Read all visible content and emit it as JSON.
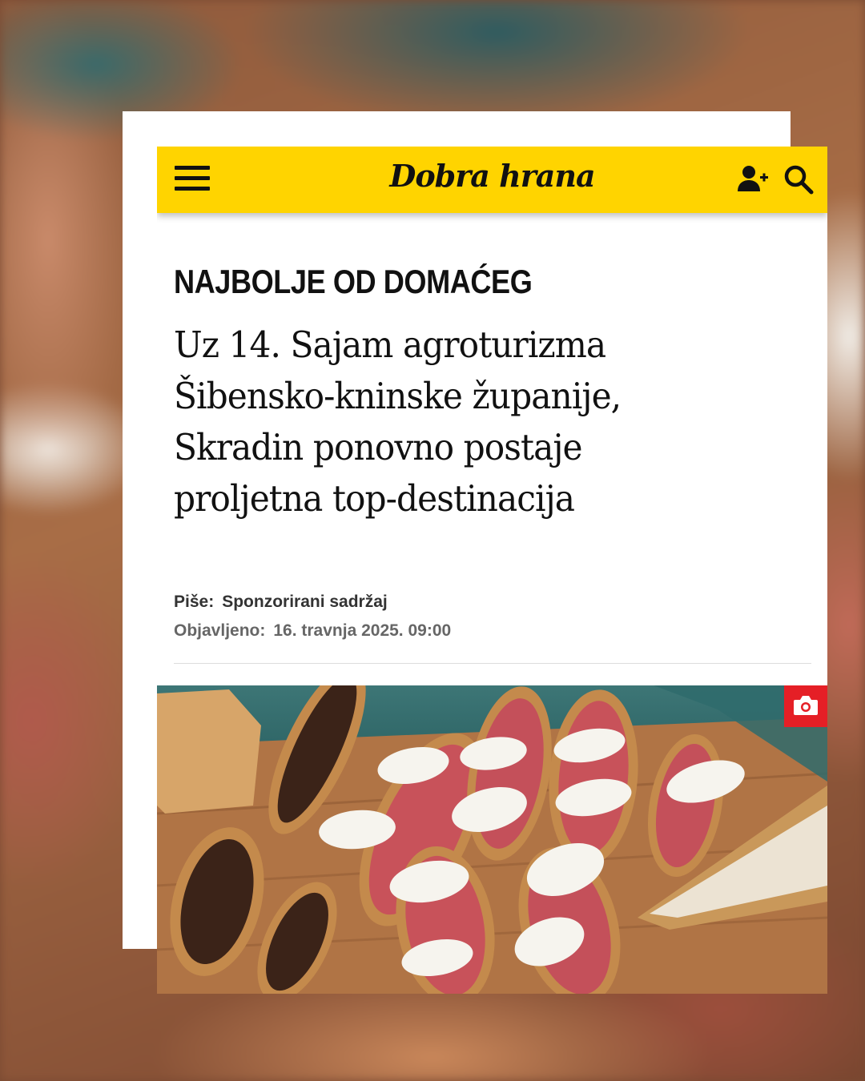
{
  "header": {
    "logo_text": "Dobra hrana"
  },
  "article": {
    "kicker": "NAJBOLJE OD DOMAĆEG",
    "headline_lines": [
      "Uz 14. Sajam agroturizma",
      "Šibensko-kninske županije,",
      "Skradin ponovno postaje",
      "proljetna top-destinacija"
    ],
    "author_label": "Piše:",
    "author_value": "Sponzorirani sadržaj",
    "published_label": "Objavljeno:",
    "published_value": "16. travnja 2025. 09:00"
  },
  "icons": {
    "menu": "hamburger-menu-icon",
    "user": "user-add-icon",
    "search": "search-icon",
    "gallery": "camera-icon"
  },
  "colors": {
    "brand_yellow": "#ffd400",
    "gallery_badge": "#e51f26"
  }
}
